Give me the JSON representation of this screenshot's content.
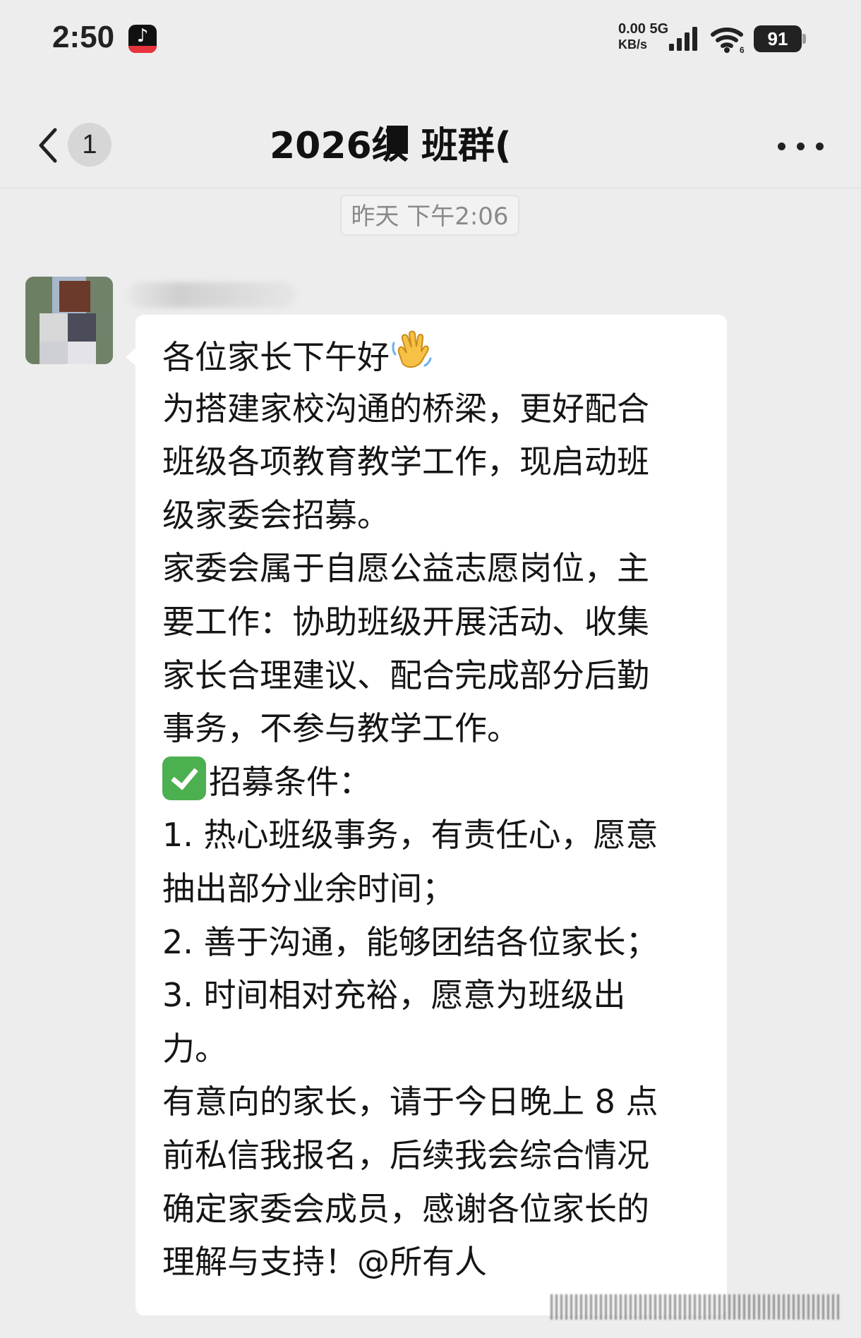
{
  "status_bar": {
    "time": "2:50",
    "app_icon": "tiktok-icon",
    "net_speed_value": "0.00",
    "net_speed_unit": "KB/s",
    "network_type": "5G",
    "wifi_icon": "wifi-icon",
    "battery_level": "91"
  },
  "title_bar": {
    "back_icon": "chevron-left-icon",
    "unread_count": "1",
    "title": "2026级  班群(",
    "more_icon": "more-dots-icon"
  },
  "chat": {
    "timestamp": "昨天 下午2:06",
    "message": {
      "lines": [
        "各位家长下午好",
        "为搭建家校沟通的桥梁，更好配合",
        "班级各项教育教学工作，现启动班",
        "级家委会招募。",
        "家委会属于自愿公益志愿岗位，主",
        "要工作：协助班级开展活动、收集",
        "家长合理建议、配合完成部分后勤",
        "事务，不参与教学工作。",
        "招募条件：",
        "1. 热心班级事务，有责任心，愿意",
        "抽出部分业余时间；",
        "2. 善于沟通，能够团结各位家长；",
        "3. 时间相对充裕，愿意为班级出",
        "力。",
        "有意向的家长，请于今日晚上 8 点",
        "前私信我报名，后续我会综合情况",
        "确定家委会成员，感谢各位家长的",
        "理解与支持！@所有人"
      ],
      "wave_emoji": "waving-hand-icon",
      "check_emoji": "check-mark-button-icon"
    }
  },
  "colors": {
    "background": "#ededed",
    "bubble": "#ffffff",
    "text": "#151515",
    "timestamp_text": "#8a8a8a",
    "check_green": "#4caf50"
  }
}
